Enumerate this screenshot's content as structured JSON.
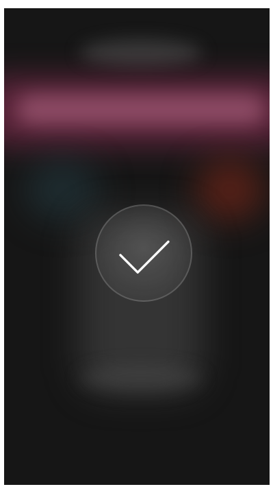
{
  "screen": {
    "state": "success",
    "icon": "checkmark-icon",
    "colors": {
      "background": "#161616",
      "accent_band": "#963a5a",
      "check_stroke": "#ffffff"
    }
  }
}
